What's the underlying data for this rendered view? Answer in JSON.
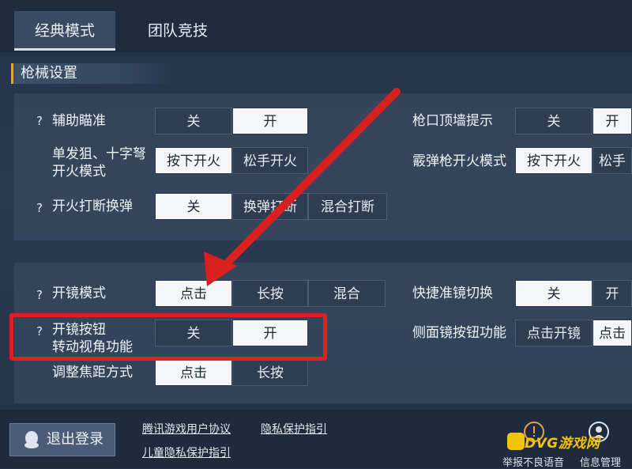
{
  "tabs": [
    {
      "label": "经典模式",
      "active": true
    },
    {
      "label": "团队竞技",
      "active": false
    }
  ],
  "section": {
    "title": "枪械设置"
  },
  "settings_group1": {
    "aim_assist": {
      "label": "辅助瞄准",
      "options": [
        "关",
        "开"
      ],
      "selected": "开"
    },
    "sniper_fire": {
      "label_line1": "单发狙、十字弩",
      "label_line2": "开火模式",
      "options": [
        "按下开火",
        "松手开火"
      ],
      "selected": "按下开火"
    },
    "fire_interrupt": {
      "label": "开火打断换弹",
      "options": [
        "关",
        "换弹打断",
        "混合打断"
      ],
      "selected": "关"
    },
    "muzzle_wall": {
      "label": "枪口顶墙提示",
      "options": [
        "关",
        "开"
      ],
      "selected": "开"
    },
    "shotgun_fire": {
      "label": "霰弹枪开火模式",
      "options": [
        "按下开火",
        "松手开火"
      ],
      "selected": "按下开火"
    }
  },
  "settings_group2": {
    "scope_mode": {
      "label": "开镜模式",
      "options": [
        "点击",
        "长按",
        "混合"
      ],
      "selected": "点击"
    },
    "scope_button_rotate": {
      "label_line1": "开镜按钮",
      "label_line2": "转动视角功能",
      "options": [
        "关",
        "开"
      ],
      "selected": "开"
    },
    "focus_adjust": {
      "label": "调整焦距方式",
      "options": [
        "点击",
        "长按"
      ],
      "selected": "点击"
    },
    "quick_scope_switch": {
      "label": "快捷准镜切换",
      "options": [
        "关",
        "开"
      ],
      "selected": "关"
    },
    "side_scope_button": {
      "label": "侧面镜按钮功能",
      "options": [
        "点击开镜",
        "点击"
      ],
      "selected": "点击开镜"
    }
  },
  "help_marker": "?",
  "footer": {
    "logout_label": "退出登录",
    "links": [
      "腾讯游戏用户协议",
      "隐私保护指引",
      "儿童隐私保护指引"
    ],
    "report_text": "举报不良语音",
    "info_text": "信息管理"
  },
  "watermark": "DVG游戏网",
  "colors": {
    "accent": "#e6a23c",
    "highlight_box": "#e02020",
    "watermark": "#f5c400"
  },
  "icons": [
    "help-icon",
    "penguin-icon",
    "warning-icon",
    "person-icon"
  ]
}
